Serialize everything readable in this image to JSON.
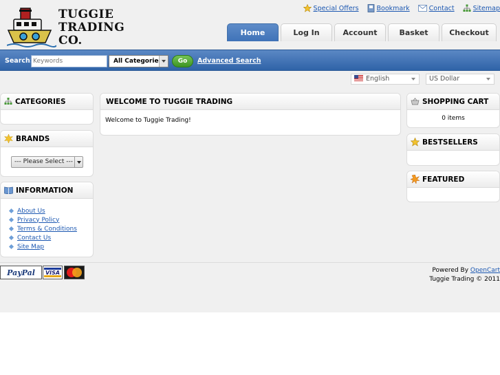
{
  "logo": {
    "line1": "TUGGIE",
    "line2": "TRADING",
    "line3": "CO."
  },
  "toplinks": [
    {
      "label": "Special Offers",
      "icon": "star-icon"
    },
    {
      "label": "Bookmark",
      "icon": "bookmark-icon"
    },
    {
      "label": "Contact",
      "icon": "envelope-icon"
    },
    {
      "label": "Sitemap",
      "icon": "sitemap-icon"
    }
  ],
  "tabs": [
    {
      "label": "Home",
      "active": true
    },
    {
      "label": "Log In"
    },
    {
      "label": "Account"
    },
    {
      "label": "Basket"
    },
    {
      "label": "Checkout"
    }
  ],
  "search": {
    "label": "Search:",
    "placeholder": "Keywords",
    "category": "All Categories",
    "go": "Go",
    "advanced": "Advanced Search"
  },
  "language": "English",
  "currency": "US Dollar",
  "left": {
    "categories": {
      "title": "CATEGORIES"
    },
    "brands": {
      "title": "BRANDS",
      "select": "--- Please Select ---"
    },
    "information": {
      "title": "INFORMATION",
      "links": [
        "About Us",
        "Privacy Policy",
        "Terms & Conditions",
        "Contact Us",
        "Site Map"
      ]
    }
  },
  "main": {
    "title": "WELCOME TO TUGGIE TRADING",
    "text": "Welcome to Tuggie Trading!"
  },
  "right": {
    "cart": {
      "title": "SHOPPING CART",
      "items": "0 items"
    },
    "bestsellers": {
      "title": "BESTSELLERS"
    },
    "featured": {
      "title": "FEATURED"
    }
  },
  "footer": {
    "paypal": "PayPal",
    "visa": "VISA",
    "powered_prefix": "Powered By",
    "powered_link": "OpenCart",
    "copyright": "Tuggie Trading © 2011"
  },
  "colors": {
    "accent": "#3f73b8",
    "link": "#1b57b1",
    "go": "#3d9422"
  }
}
